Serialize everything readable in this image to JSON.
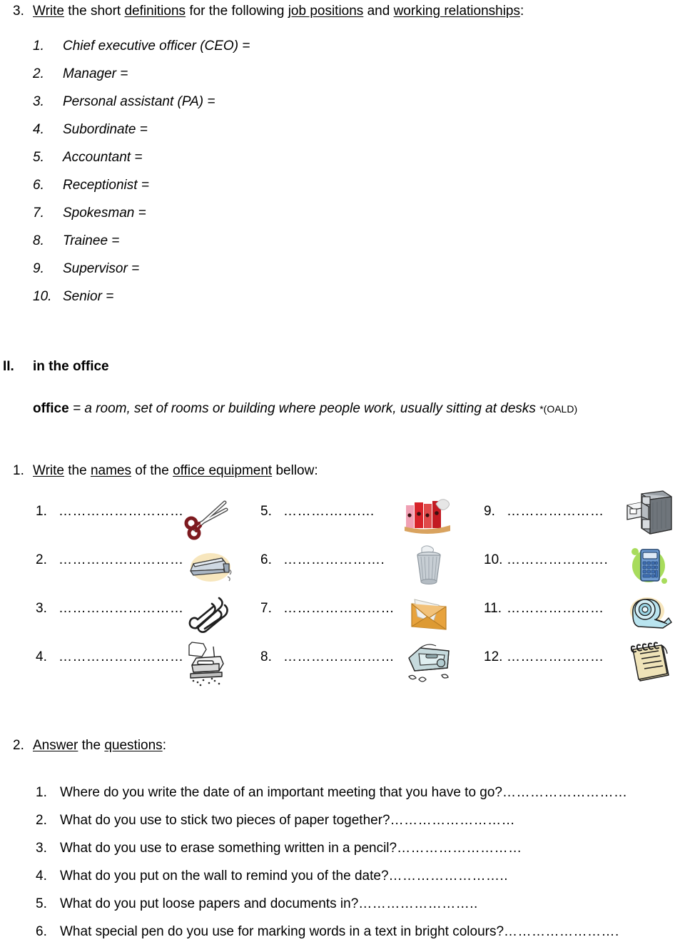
{
  "document": {
    "section_3": {
      "number": "3.",
      "heading_parts": [
        {
          "text": "Write",
          "underline": true
        },
        {
          "text": " the short ",
          "underline": false
        },
        {
          "text": "definitions",
          "underline": true
        },
        {
          "text": " for the following ",
          "underline": false
        },
        {
          "text": "job positions",
          "underline": true
        },
        {
          "text": " and ",
          "underline": false
        },
        {
          "text": "working relationships",
          "underline": true
        },
        {
          "text": ":",
          "underline": false
        }
      ],
      "heading_plain": "Write the short definitions for the following job positions and working relationships:",
      "items": [
        {
          "number": "1.",
          "text": "Chief executive officer (CEO) ="
        },
        {
          "number": "2.",
          "text": "Manager ="
        },
        {
          "number": "3.",
          "text": "Personal assistant (PA) ="
        },
        {
          "number": "4.",
          "text": "Subordinate ="
        },
        {
          "number": "5.",
          "text": "Accountant ="
        },
        {
          "number": "6.",
          "text": "Receptionist ="
        },
        {
          "number": "7.",
          "text": "Spokesman ="
        },
        {
          "number": "8.",
          "text": "Trainee ="
        },
        {
          "number": "9.",
          "text": "Supervisor ="
        },
        {
          "number": "10.",
          "text": "Senior ="
        }
      ]
    },
    "section_II": {
      "marker": "II.",
      "title": "in the office",
      "definition": {
        "term": "office",
        "body": " = a room, set of rooms or building where people work, usually sitting at desks ",
        "source": "*(OALD)"
      }
    },
    "task_1": {
      "number": "1.",
      "heading_parts": [
        {
          "text": "Write",
          "underline": true
        },
        {
          "text": " the ",
          "underline": false
        },
        {
          "text": "names",
          "underline": true
        },
        {
          "text": " of the ",
          "underline": false
        },
        {
          "text": "office equipment",
          "underline": true
        },
        {
          "text": " bellow:",
          "underline": false
        }
      ],
      "heading_plain": "Write the names of the office equipment bellow:",
      "blank_dots": "……………………",
      "columns": [
        {
          "items": [
            {
              "index": "1.",
              "dots": "………………………",
              "icon": "scissors-icon"
            },
            {
              "index": "2.",
              "dots": "………………………",
              "icon": "stapler-icon"
            },
            {
              "index": "3.",
              "dots": "………………………",
              "icon": "paper-clips-icon"
            },
            {
              "index": "4.",
              "dots": "………………………",
              "icon": "hole-punch-icon"
            }
          ]
        },
        {
          "items": [
            {
              "index": "5.",
              "dots": "……….…….…",
              "icon": "ring-binders-icon"
            },
            {
              "index": "6.",
              "dots": "………………….",
              "icon": "wastepaper-basket-icon"
            },
            {
              "index": "7.",
              "dots": "……………………",
              "icon": "envelope-icon"
            },
            {
              "index": "8.",
              "dots": "……………………",
              "icon": "pencil-sharpener-icon"
            }
          ]
        },
        {
          "items": [
            {
              "index": "9.",
              "dots": "…………………",
              "icon": "filing-cabinet-icon"
            },
            {
              "index": "10.",
              "dots": "………………….",
              "icon": "calculator-icon"
            },
            {
              "index": "11.",
              "dots": "…………………",
              "icon": "tape-dispenser-icon"
            },
            {
              "index": "12.",
              "dots": "…………………",
              "icon": "notepad-icon"
            }
          ]
        }
      ]
    },
    "task_2": {
      "number": "2.",
      "heading_parts": [
        {
          "text": "Answer",
          "underline": true
        },
        {
          "text": " the ",
          "underline": false
        },
        {
          "text": "questions",
          "underline": true
        },
        {
          "text": ":",
          "underline": false
        }
      ],
      "heading_plain": "Answer the questions:",
      "questions": [
        {
          "number": "1.",
          "text": "Where do you write the date of an important meeting that you have to go?",
          "dots": "………………………"
        },
        {
          "number": "2.",
          "text": "What do you use to stick two pieces of paper together?",
          "dots": "………………………"
        },
        {
          "number": "3.",
          "text": "What do you use to erase something written in a pencil?",
          "dots": "………………………"
        },
        {
          "number": "4.",
          "text": "What do you put on the wall to remind you of the date?",
          "dots": "…………………….."
        },
        {
          "number": "5.",
          "text": "What do you put loose papers and documents in?",
          "dots": "…………………….."
        },
        {
          "number": "6.",
          "text": "What special pen do you use for marking words in a text in bright colours?",
          "dots": "……………………."
        }
      ]
    }
  },
  "colors": {
    "text": "#000000",
    "page_background": "#ffffff",
    "scissors_handle": "#7d1a1f",
    "stapler_body": "#b9c3cf",
    "stapler_blob": "#f7e6bd",
    "binder_red": "#d8232a",
    "binder_pink": "#f0a0b4",
    "envelope_orange": "#e8a33d",
    "calculator_blue": "#3f6fb5",
    "calculator_blob": "#a8dc5c",
    "tape_blue": "#b9e4ef",
    "tape_blob": "#f7e6bd",
    "notepad_cream": "#efe3b8",
    "basket_gray": "#c0c6cc",
    "cabinet_gray": "#8d9298",
    "sharpener_blue": "#bcd4d6"
  }
}
